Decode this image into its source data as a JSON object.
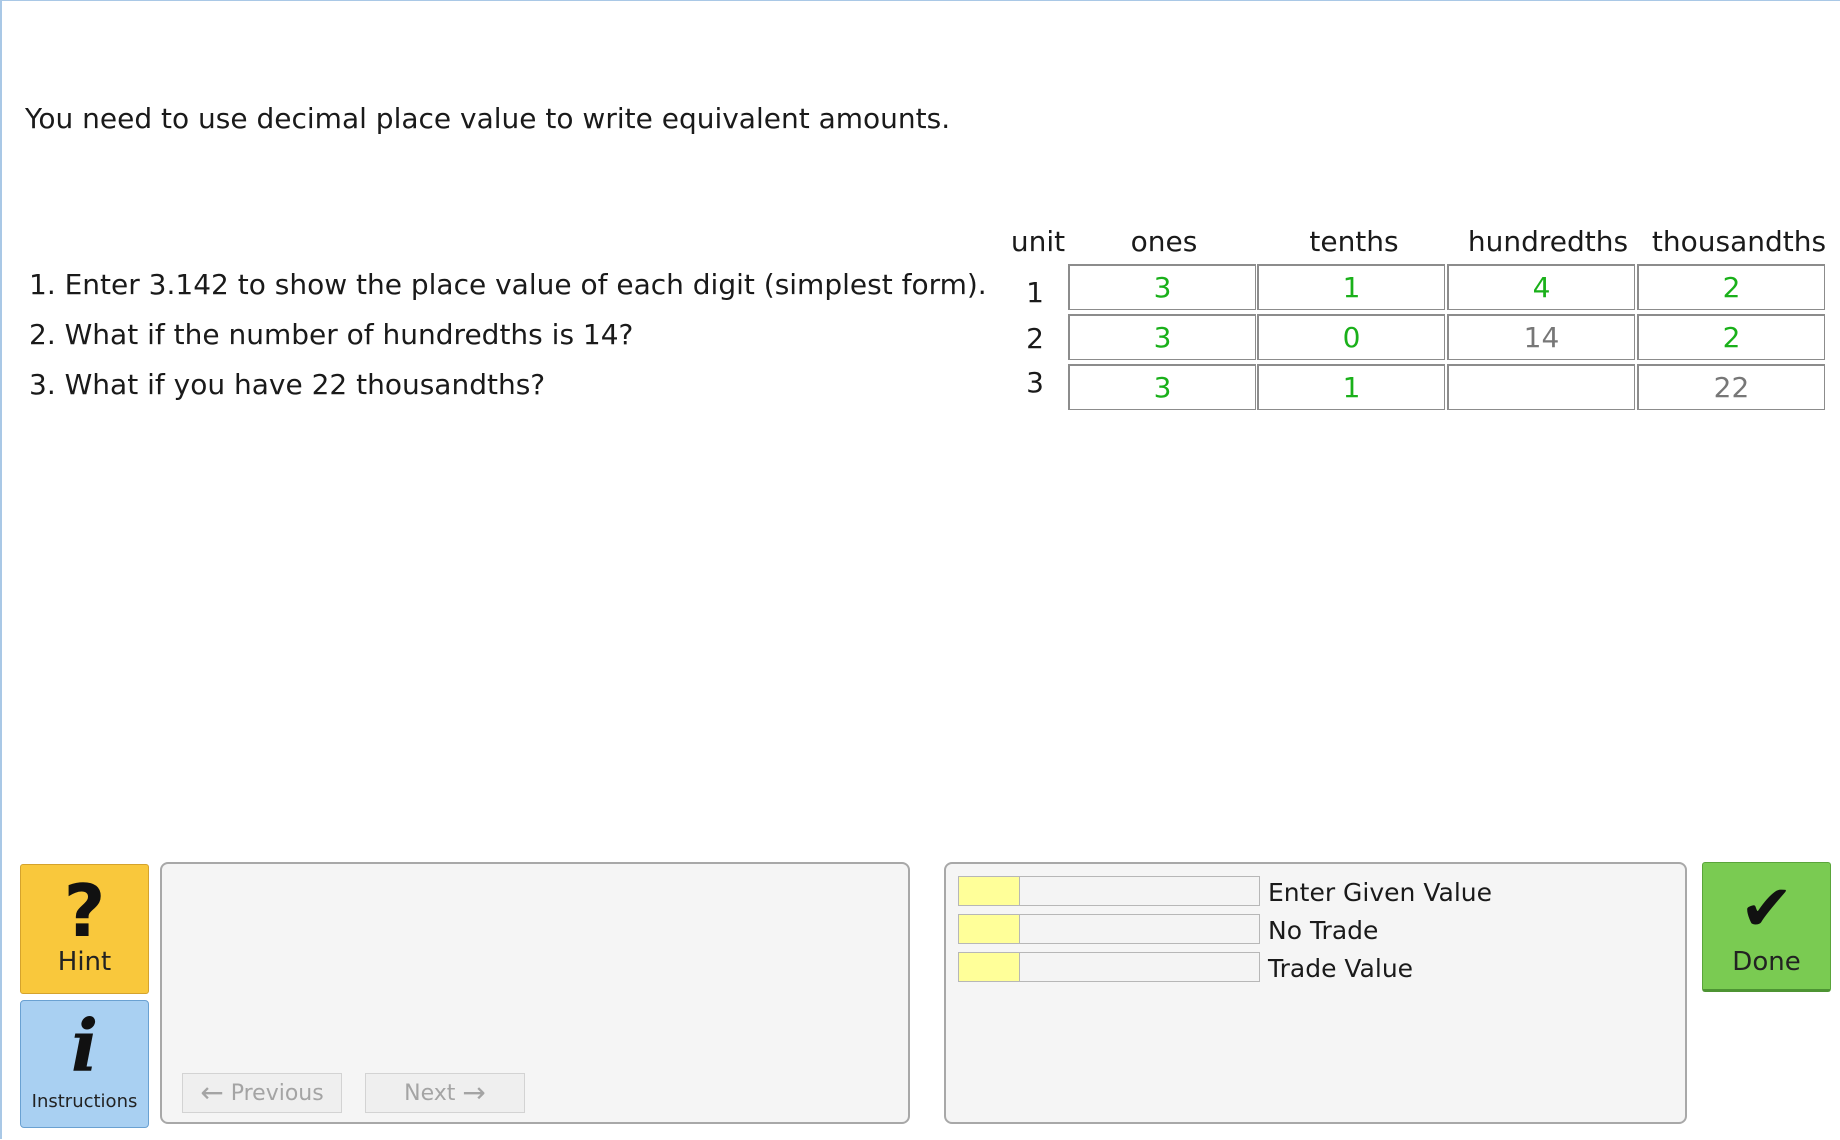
{
  "intro": "You need to use decimal place value to write equivalent amounts.",
  "questions": [
    "1. Enter 3.142 to show the place value of each digit (simplest form).",
    "2. What if the number of hundredths is 14?",
    "3. What if you have 22 thousandths?"
  ],
  "table": {
    "headers": [
      "unit",
      "ones",
      "tenths",
      "hundredths",
      "thousandths"
    ],
    "rows": [
      {
        "unit": "1",
        "cells": [
          "3",
          "1",
          "4",
          "2"
        ]
      },
      {
        "unit": "2",
        "cells": [
          "3",
          "0",
          "14",
          "2"
        ]
      },
      {
        "unit": "3",
        "cells": [
          "3",
          "1",
          "",
          "22"
        ]
      }
    ]
  },
  "colors": {
    "given_value": "#1ab01a",
    "plain_value": "#777777",
    "hint": "#f9c83c",
    "instructions": "#a9d0f2",
    "done": "#7acb52",
    "skill_fill": "#ffff99"
  },
  "buttons": {
    "hint": {
      "label": "Hint",
      "icon": "question-mark-icon"
    },
    "instructions": {
      "label": "Instructions",
      "icon": "info-icon"
    },
    "previous": "Previous",
    "next": "Next",
    "done": {
      "label": "Done",
      "icon": "checkmark-icon"
    }
  },
  "skills": [
    {
      "label": "Enter Given Value",
      "level": 0.2
    },
    {
      "label": "No Trade",
      "level": 0.2
    },
    {
      "label": "Trade Value",
      "level": 0.2
    }
  ]
}
